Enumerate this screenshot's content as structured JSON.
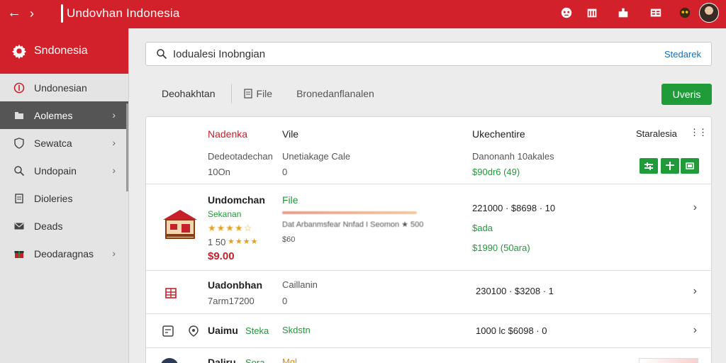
{
  "app": {
    "title": "Undovhan Indonesia"
  },
  "header": {
    "back_icon": "arrow-left-icon",
    "forward_icon": "chevron-right-icon",
    "icons": [
      "robot-icon",
      "calendar-icon",
      "bag-icon",
      "list-icon",
      "gamepad-icon"
    ]
  },
  "sidebar": {
    "title": "Sndonesia",
    "items": [
      {
        "label": "Undonesian",
        "icon": "circle-icon"
      },
      {
        "label": "Aolemes",
        "icon": "folder-icon",
        "active": true
      },
      {
        "label": "Sewatca",
        "icon": "shield-icon"
      },
      {
        "label": "Undopain",
        "icon": "search-icon"
      },
      {
        "label": "Dioleries",
        "icon": "document-icon"
      },
      {
        "label": "Deads",
        "icon": "mail-icon"
      },
      {
        "label": "Deodaragnas",
        "icon": "gift-icon"
      }
    ]
  },
  "search": {
    "value": "Iodualesi Inobngian",
    "button": "Stedarek"
  },
  "toolbar": {
    "left": "Deohakhtan",
    "file": "File",
    "link": "Bronedanflanalen",
    "action_button": "Uveris"
  },
  "table": {
    "header": {
      "col1_title": "Nadenka",
      "col1_sub": "Dedeotadechan",
      "col1_val": "10Оn",
      "col2_title": "Vile",
      "col2_sub": "Unetiakage Cale",
      "col2_val": "0",
      "col3_title": "Ukechentire",
      "col3_sub": "Danonanh 10akales",
      "col3_val": "$90dr6 (49)",
      "col4_title": "Staralesia",
      "col4_icon": "more-icon"
    },
    "rows": [
      {
        "title": "Undomchan",
        "subtitle": "Sekanan",
        "rating_text": "1 50",
        "price": "$9.00",
        "col2_title": "File",
        "col2_line": "Dat Arbanmsfear Nnfad I Seomon ★ 500",
        "col2_sub": "$60",
        "col3_line1": "221000 · $8698 · 10",
        "col3_line2": "$ada",
        "col3_line3": "$1990 (50ara)"
      },
      {
        "title": "Uadonbhan",
        "subtitle": "7arm17200",
        "col2_title": "Caillanin",
        "col2_val": "0",
        "col3_line1": "230100 · $3208 · 1"
      },
      {
        "title": "Uaimu",
        "tag": "Steka",
        "col2_title": "Skdstn",
        "col3_line1": "1000 lc $6098 · 0"
      },
      {
        "title": "Daliru",
        "tag": "Sora",
        "col2_title": "Mgl"
      }
    ]
  }
}
